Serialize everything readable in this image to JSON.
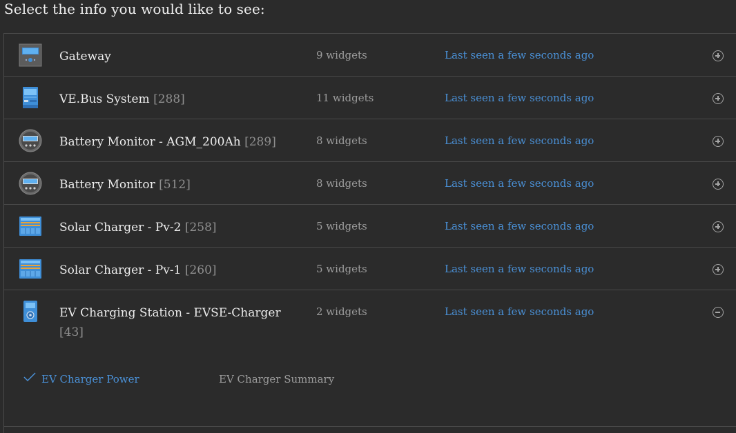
{
  "page": {
    "title": "Select the info you would like to see:"
  },
  "devices": [
    {
      "name": "Gateway",
      "id": "",
      "widgets": "9 widgets",
      "last_seen": "Last seen a few seconds ago",
      "icon": "gateway-icon",
      "expanded": false
    },
    {
      "name": "VE.Bus System",
      "id": "[288]",
      "widgets": "11 widgets",
      "last_seen": "Last seen a few seconds ago",
      "icon": "inverter-icon",
      "expanded": false
    },
    {
      "name": "Battery Monitor - AGM_200Ah",
      "id": "[289]",
      "widgets": "8 widgets",
      "last_seen": "Last seen a few seconds ago",
      "icon": "battery-monitor-icon",
      "expanded": false
    },
    {
      "name": "Battery Monitor",
      "id": "[512]",
      "widgets": "8 widgets",
      "last_seen": "Last seen a few seconds ago",
      "icon": "battery-monitor-icon",
      "expanded": false
    },
    {
      "name": "Solar Charger - Pv-2",
      "id": "[258]",
      "widgets": "5 widgets",
      "last_seen": "Last seen a few seconds ago",
      "icon": "solar-charger-icon",
      "expanded": false
    },
    {
      "name": "Solar Charger - Pv-1",
      "id": "[260]",
      "widgets": "5 widgets",
      "last_seen": "Last seen a few seconds ago",
      "icon": "solar-charger-icon",
      "expanded": false
    },
    {
      "name": "EV Charging Station - EVSE-Charger",
      "id": "[43]",
      "widgets": "2 widgets",
      "last_seen": "Last seen a few seconds ago",
      "icon": "ev-charger-icon",
      "expanded": true,
      "widget_options": [
        {
          "label": "EV Charger Power",
          "selected": true
        },
        {
          "label": "EV Charger Summary",
          "selected": false
        }
      ]
    }
  ],
  "colors": {
    "accent": "#4a90d6",
    "background": "#2b2b2b",
    "divider": "#4a4a4a"
  }
}
